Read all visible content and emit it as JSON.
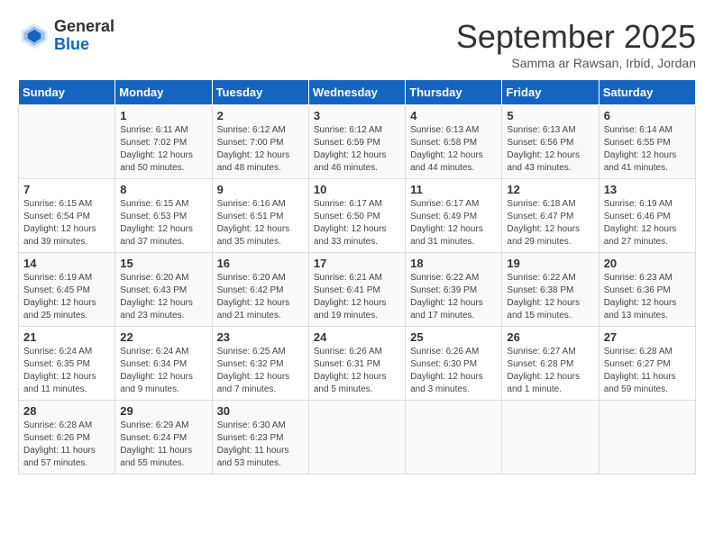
{
  "logo": {
    "general": "General",
    "blue": "Blue"
  },
  "header": {
    "month": "September 2025",
    "location": "Samma ar Rawsan, Irbid, Jordan"
  },
  "days": [
    "Sunday",
    "Monday",
    "Tuesday",
    "Wednesday",
    "Thursday",
    "Friday",
    "Saturday"
  ],
  "weeks": [
    [
      {
        "day": "",
        "content": ""
      },
      {
        "day": "1",
        "content": "Sunrise: 6:11 AM\nSunset: 7:02 PM\nDaylight: 12 hours\nand 50 minutes."
      },
      {
        "day": "2",
        "content": "Sunrise: 6:12 AM\nSunset: 7:00 PM\nDaylight: 12 hours\nand 48 minutes."
      },
      {
        "day": "3",
        "content": "Sunrise: 6:12 AM\nSunset: 6:59 PM\nDaylight: 12 hours\nand 46 minutes."
      },
      {
        "day": "4",
        "content": "Sunrise: 6:13 AM\nSunset: 6:58 PM\nDaylight: 12 hours\nand 44 minutes."
      },
      {
        "day": "5",
        "content": "Sunrise: 6:13 AM\nSunset: 6:56 PM\nDaylight: 12 hours\nand 43 minutes."
      },
      {
        "day": "6",
        "content": "Sunrise: 6:14 AM\nSunset: 6:55 PM\nDaylight: 12 hours\nand 41 minutes."
      }
    ],
    [
      {
        "day": "7",
        "content": "Sunrise: 6:15 AM\nSunset: 6:54 PM\nDaylight: 12 hours\nand 39 minutes."
      },
      {
        "day": "8",
        "content": "Sunrise: 6:15 AM\nSunset: 6:53 PM\nDaylight: 12 hours\nand 37 minutes."
      },
      {
        "day": "9",
        "content": "Sunrise: 6:16 AM\nSunset: 6:51 PM\nDaylight: 12 hours\nand 35 minutes."
      },
      {
        "day": "10",
        "content": "Sunrise: 6:17 AM\nSunset: 6:50 PM\nDaylight: 12 hours\nand 33 minutes."
      },
      {
        "day": "11",
        "content": "Sunrise: 6:17 AM\nSunset: 6:49 PM\nDaylight: 12 hours\nand 31 minutes."
      },
      {
        "day": "12",
        "content": "Sunrise: 6:18 AM\nSunset: 6:47 PM\nDaylight: 12 hours\nand 29 minutes."
      },
      {
        "day": "13",
        "content": "Sunrise: 6:19 AM\nSunset: 6:46 PM\nDaylight: 12 hours\nand 27 minutes."
      }
    ],
    [
      {
        "day": "14",
        "content": "Sunrise: 6:19 AM\nSunset: 6:45 PM\nDaylight: 12 hours\nand 25 minutes."
      },
      {
        "day": "15",
        "content": "Sunrise: 6:20 AM\nSunset: 6:43 PM\nDaylight: 12 hours\nand 23 minutes."
      },
      {
        "day": "16",
        "content": "Sunrise: 6:20 AM\nSunset: 6:42 PM\nDaylight: 12 hours\nand 21 minutes."
      },
      {
        "day": "17",
        "content": "Sunrise: 6:21 AM\nSunset: 6:41 PM\nDaylight: 12 hours\nand 19 minutes."
      },
      {
        "day": "18",
        "content": "Sunrise: 6:22 AM\nSunset: 6:39 PM\nDaylight: 12 hours\nand 17 minutes."
      },
      {
        "day": "19",
        "content": "Sunrise: 6:22 AM\nSunset: 6:38 PM\nDaylight: 12 hours\nand 15 minutes."
      },
      {
        "day": "20",
        "content": "Sunrise: 6:23 AM\nSunset: 6:36 PM\nDaylight: 12 hours\nand 13 minutes."
      }
    ],
    [
      {
        "day": "21",
        "content": "Sunrise: 6:24 AM\nSunset: 6:35 PM\nDaylight: 12 hours\nand 11 minutes."
      },
      {
        "day": "22",
        "content": "Sunrise: 6:24 AM\nSunset: 6:34 PM\nDaylight: 12 hours\nand 9 minutes."
      },
      {
        "day": "23",
        "content": "Sunrise: 6:25 AM\nSunset: 6:32 PM\nDaylight: 12 hours\nand 7 minutes."
      },
      {
        "day": "24",
        "content": "Sunrise: 6:26 AM\nSunset: 6:31 PM\nDaylight: 12 hours\nand 5 minutes."
      },
      {
        "day": "25",
        "content": "Sunrise: 6:26 AM\nSunset: 6:30 PM\nDaylight: 12 hours\nand 3 minutes."
      },
      {
        "day": "26",
        "content": "Sunrise: 6:27 AM\nSunset: 6:28 PM\nDaylight: 12 hours\nand 1 minute."
      },
      {
        "day": "27",
        "content": "Sunrise: 6:28 AM\nSunset: 6:27 PM\nDaylight: 11 hours\nand 59 minutes."
      }
    ],
    [
      {
        "day": "28",
        "content": "Sunrise: 6:28 AM\nSunset: 6:26 PM\nDaylight: 11 hours\nand 57 minutes."
      },
      {
        "day": "29",
        "content": "Sunrise: 6:29 AM\nSunset: 6:24 PM\nDaylight: 11 hours\nand 55 minutes."
      },
      {
        "day": "30",
        "content": "Sunrise: 6:30 AM\nSunset: 6:23 PM\nDaylight: 11 hours\nand 53 minutes."
      },
      {
        "day": "",
        "content": ""
      },
      {
        "day": "",
        "content": ""
      },
      {
        "day": "",
        "content": ""
      },
      {
        "day": "",
        "content": ""
      }
    ]
  ]
}
